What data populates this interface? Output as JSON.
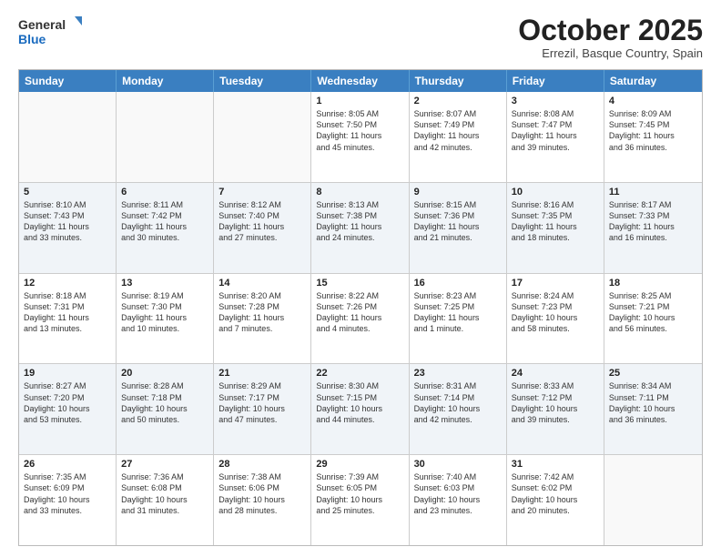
{
  "header": {
    "logo_general": "General",
    "logo_blue": "Blue",
    "month": "October 2025",
    "location": "Errezil, Basque Country, Spain"
  },
  "days_of_week": [
    "Sunday",
    "Monday",
    "Tuesday",
    "Wednesday",
    "Thursday",
    "Friday",
    "Saturday"
  ],
  "weeks": [
    [
      {
        "day": "",
        "info": ""
      },
      {
        "day": "",
        "info": ""
      },
      {
        "day": "",
        "info": ""
      },
      {
        "day": "1",
        "info": "Sunrise: 8:05 AM\nSunset: 7:50 PM\nDaylight: 11 hours\nand 45 minutes."
      },
      {
        "day": "2",
        "info": "Sunrise: 8:07 AM\nSunset: 7:49 PM\nDaylight: 11 hours\nand 42 minutes."
      },
      {
        "day": "3",
        "info": "Sunrise: 8:08 AM\nSunset: 7:47 PM\nDaylight: 11 hours\nand 39 minutes."
      },
      {
        "day": "4",
        "info": "Sunrise: 8:09 AM\nSunset: 7:45 PM\nDaylight: 11 hours\nand 36 minutes."
      }
    ],
    [
      {
        "day": "5",
        "info": "Sunrise: 8:10 AM\nSunset: 7:43 PM\nDaylight: 11 hours\nand 33 minutes."
      },
      {
        "day": "6",
        "info": "Sunrise: 8:11 AM\nSunset: 7:42 PM\nDaylight: 11 hours\nand 30 minutes."
      },
      {
        "day": "7",
        "info": "Sunrise: 8:12 AM\nSunset: 7:40 PM\nDaylight: 11 hours\nand 27 minutes."
      },
      {
        "day": "8",
        "info": "Sunrise: 8:13 AM\nSunset: 7:38 PM\nDaylight: 11 hours\nand 24 minutes."
      },
      {
        "day": "9",
        "info": "Sunrise: 8:15 AM\nSunset: 7:36 PM\nDaylight: 11 hours\nand 21 minutes."
      },
      {
        "day": "10",
        "info": "Sunrise: 8:16 AM\nSunset: 7:35 PM\nDaylight: 11 hours\nand 18 minutes."
      },
      {
        "day": "11",
        "info": "Sunrise: 8:17 AM\nSunset: 7:33 PM\nDaylight: 11 hours\nand 16 minutes."
      }
    ],
    [
      {
        "day": "12",
        "info": "Sunrise: 8:18 AM\nSunset: 7:31 PM\nDaylight: 11 hours\nand 13 minutes."
      },
      {
        "day": "13",
        "info": "Sunrise: 8:19 AM\nSunset: 7:30 PM\nDaylight: 11 hours\nand 10 minutes."
      },
      {
        "day": "14",
        "info": "Sunrise: 8:20 AM\nSunset: 7:28 PM\nDaylight: 11 hours\nand 7 minutes."
      },
      {
        "day": "15",
        "info": "Sunrise: 8:22 AM\nSunset: 7:26 PM\nDaylight: 11 hours\nand 4 minutes."
      },
      {
        "day": "16",
        "info": "Sunrise: 8:23 AM\nSunset: 7:25 PM\nDaylight: 11 hours\nand 1 minute."
      },
      {
        "day": "17",
        "info": "Sunrise: 8:24 AM\nSunset: 7:23 PM\nDaylight: 10 hours\nand 58 minutes."
      },
      {
        "day": "18",
        "info": "Sunrise: 8:25 AM\nSunset: 7:21 PM\nDaylight: 10 hours\nand 56 minutes."
      }
    ],
    [
      {
        "day": "19",
        "info": "Sunrise: 8:27 AM\nSunset: 7:20 PM\nDaylight: 10 hours\nand 53 minutes."
      },
      {
        "day": "20",
        "info": "Sunrise: 8:28 AM\nSunset: 7:18 PM\nDaylight: 10 hours\nand 50 minutes."
      },
      {
        "day": "21",
        "info": "Sunrise: 8:29 AM\nSunset: 7:17 PM\nDaylight: 10 hours\nand 47 minutes."
      },
      {
        "day": "22",
        "info": "Sunrise: 8:30 AM\nSunset: 7:15 PM\nDaylight: 10 hours\nand 44 minutes."
      },
      {
        "day": "23",
        "info": "Sunrise: 8:31 AM\nSunset: 7:14 PM\nDaylight: 10 hours\nand 42 minutes."
      },
      {
        "day": "24",
        "info": "Sunrise: 8:33 AM\nSunset: 7:12 PM\nDaylight: 10 hours\nand 39 minutes."
      },
      {
        "day": "25",
        "info": "Sunrise: 8:34 AM\nSunset: 7:11 PM\nDaylight: 10 hours\nand 36 minutes."
      }
    ],
    [
      {
        "day": "26",
        "info": "Sunrise: 7:35 AM\nSunset: 6:09 PM\nDaylight: 10 hours\nand 33 minutes."
      },
      {
        "day": "27",
        "info": "Sunrise: 7:36 AM\nSunset: 6:08 PM\nDaylight: 10 hours\nand 31 minutes."
      },
      {
        "day": "28",
        "info": "Sunrise: 7:38 AM\nSunset: 6:06 PM\nDaylight: 10 hours\nand 28 minutes."
      },
      {
        "day": "29",
        "info": "Sunrise: 7:39 AM\nSunset: 6:05 PM\nDaylight: 10 hours\nand 25 minutes."
      },
      {
        "day": "30",
        "info": "Sunrise: 7:40 AM\nSunset: 6:03 PM\nDaylight: 10 hours\nand 23 minutes."
      },
      {
        "day": "31",
        "info": "Sunrise: 7:42 AM\nSunset: 6:02 PM\nDaylight: 10 hours\nand 20 minutes."
      },
      {
        "day": "",
        "info": ""
      }
    ]
  ]
}
